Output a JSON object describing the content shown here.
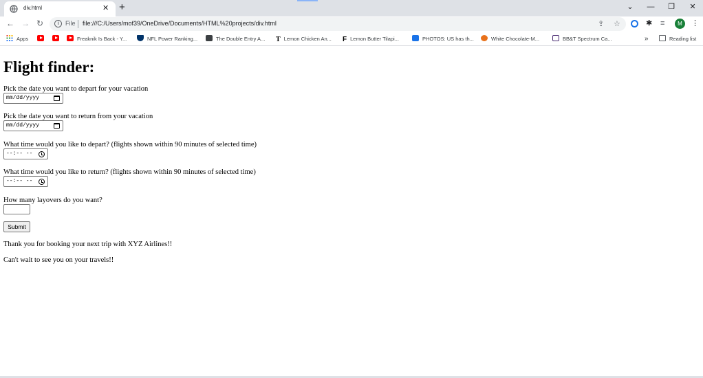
{
  "browser": {
    "tab_title": "div.html",
    "tab_close": "✕",
    "new_tab": "+",
    "window_controls": {
      "minimize": "—",
      "restore": "❐",
      "close": "✕",
      "tab_search": "⌄"
    },
    "nav": {
      "back": "←",
      "forward": "→",
      "reload": "↻"
    },
    "address": {
      "scheme_label": "File",
      "url": "file:///C:/Users/mof39/OneDrive/Documents/HTML%20projects/div.html",
      "share_icon": "⇪",
      "bookmark_star": "☆"
    },
    "toolbar_icons": {
      "extensions": "✱",
      "media": "≡",
      "avatar_letter": "M",
      "menu": "⋮"
    },
    "bookmarks": [
      {
        "label": "Apps",
        "icon": "apps-grid-icon"
      },
      {
        "label": "",
        "icon": "youtube-icon"
      },
      {
        "label": "",
        "icon": "youtube-icon"
      },
      {
        "label": "Freaknik Is Back - Y...",
        "icon": "youtube-icon"
      },
      {
        "label": "NFL Power Ranking...",
        "icon": "nfl-icon"
      },
      {
        "label": "The Double Entry A...",
        "icon": "atlantic-icon"
      },
      {
        "label": "Lemon Chicken An...",
        "icon": "t-icon"
      },
      {
        "label": "Lemon Butter Tilapi...",
        "icon": "f-icon"
      },
      {
        "label": "PHOTOS: US has th...",
        "icon": "news-icon"
      },
      {
        "label": "White Chocolate-M...",
        "icon": "allrecipes-icon"
      },
      {
        "label": "BB&T Spectrum Ca...",
        "icon": "bbt-icon"
      }
    ],
    "bookmarks_overflow": "»",
    "reading_list": "Reading list"
  },
  "page": {
    "heading": "Flight finder:",
    "depart_date_label": "Pick the date you want to depart for your vacation",
    "depart_date_placeholder": "mm/dd/yyyy",
    "return_date_label": "Pick the date you want to return from your vacation",
    "return_date_placeholder": "mm/dd/yyyy",
    "depart_time_label": "What time would you like to depart? (flights shown within 90 minutes of selected time)",
    "depart_time_placeholder": "--:-- --",
    "return_time_label": "What time would you like to return? (flights shown within 90 minutes of selected time)",
    "return_time_placeholder": "--:-- --",
    "layovers_label": "How many layovers do you want?",
    "layovers_value": "",
    "submit_label": "Submit",
    "thanks_line": "Thank you for booking your next trip with XYZ Airlines!!",
    "farewell_line": "Can't wait to see you on your travels!!"
  }
}
